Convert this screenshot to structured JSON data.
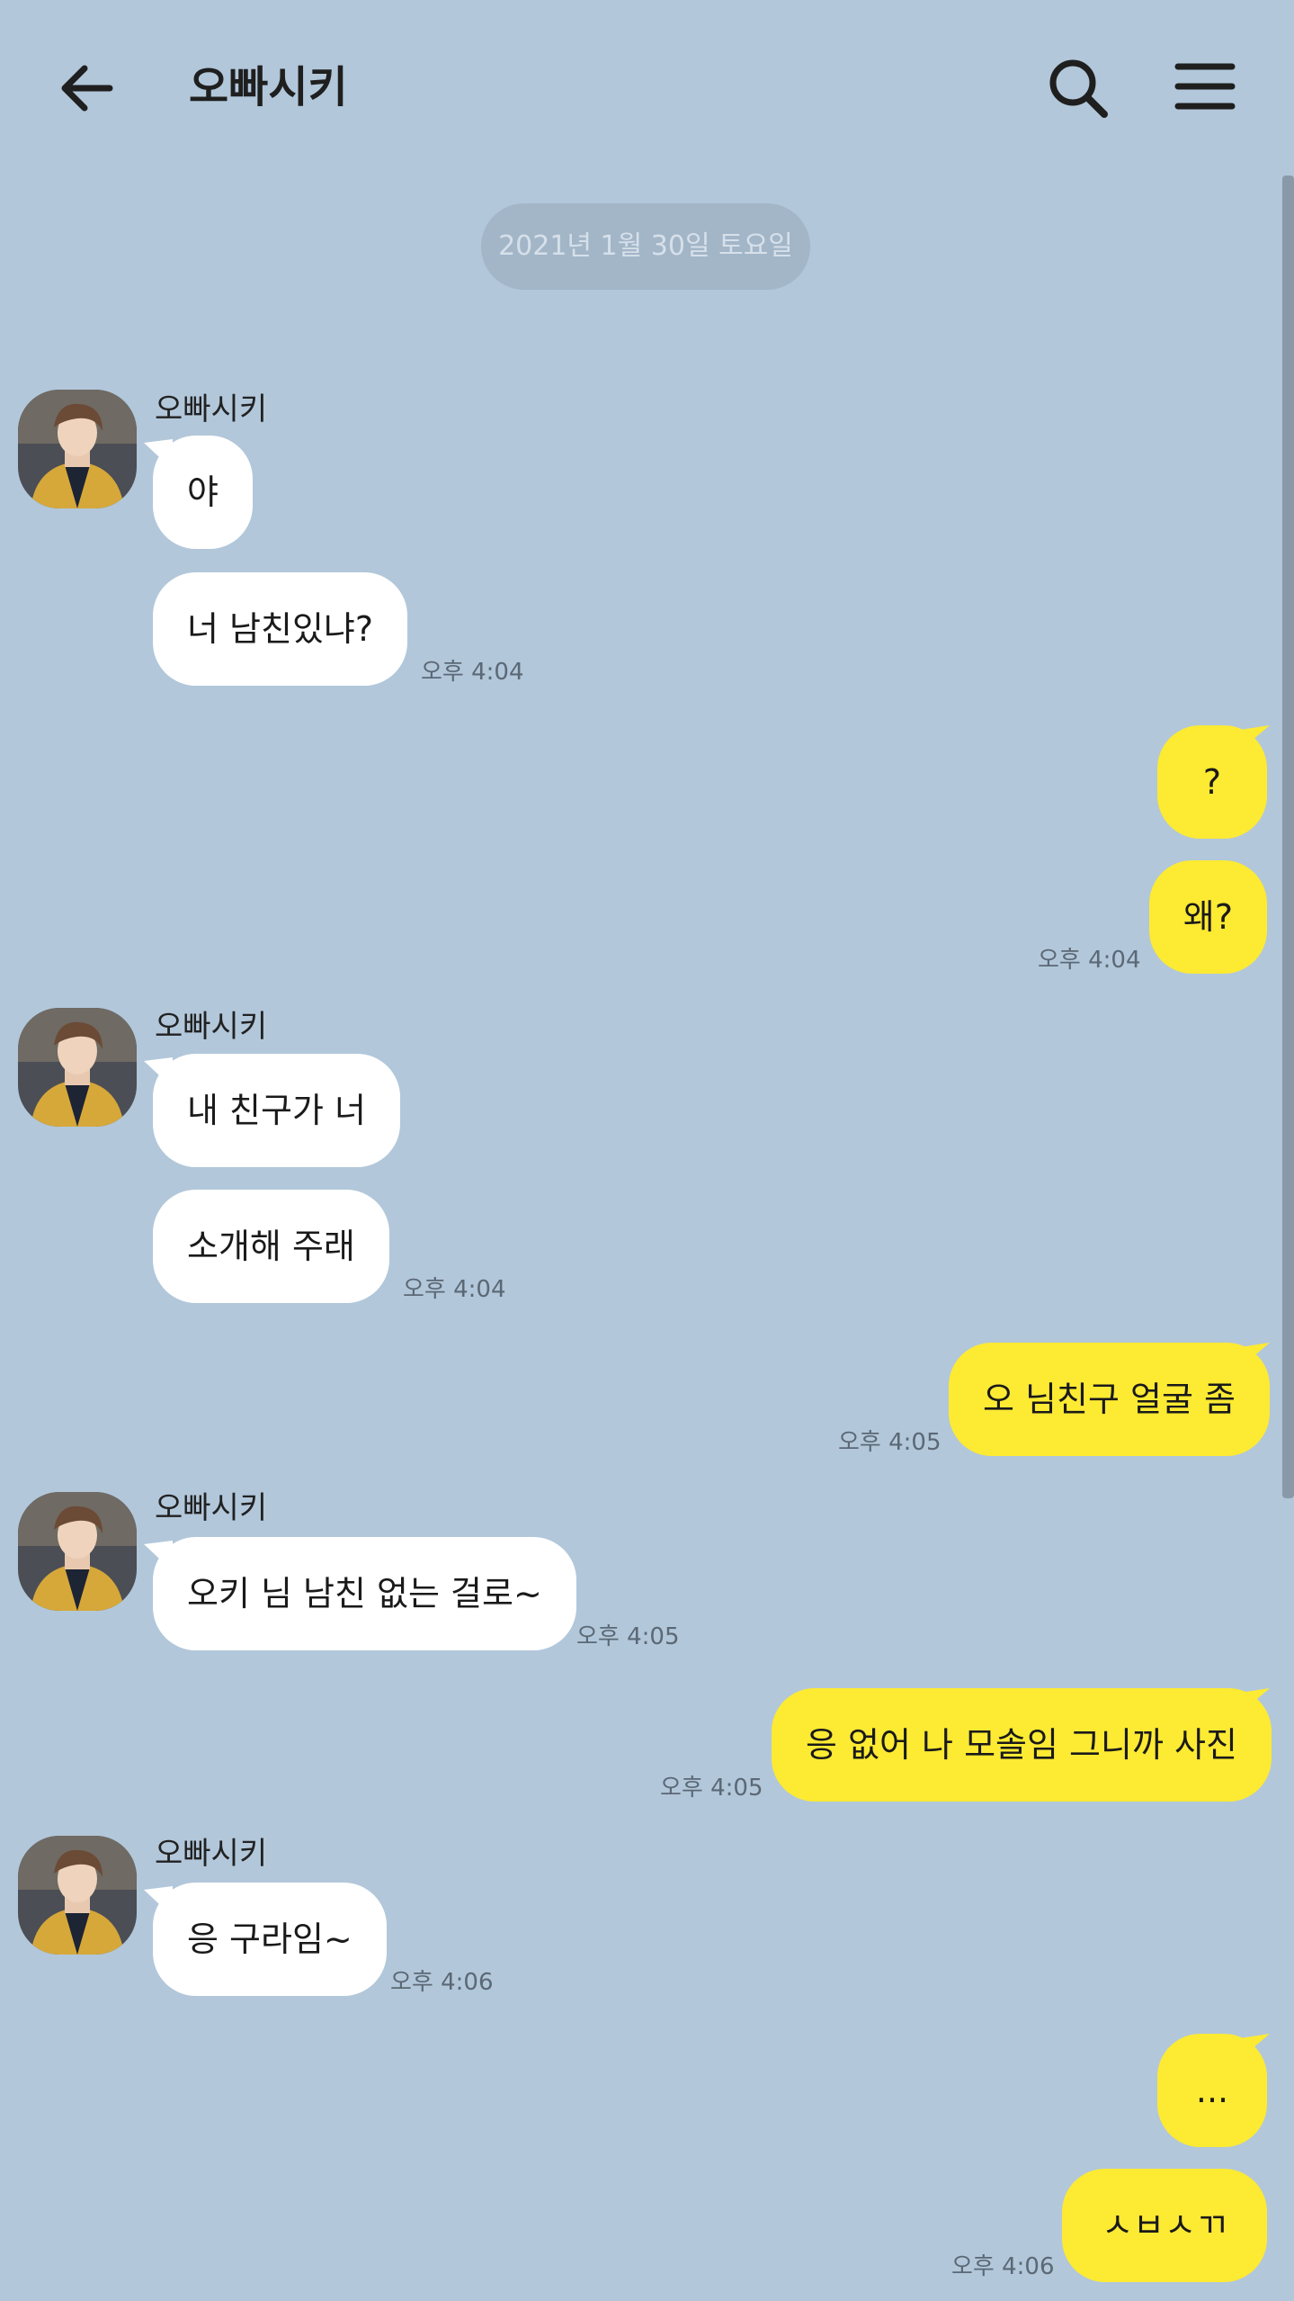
{
  "header": {
    "title": "오빠시키",
    "back_icon": "arrow-left-icon",
    "search_icon": "search-icon",
    "menu_icon": "hamburger-menu-icon"
  },
  "date_divider": "2021년 1월 30일 토요일",
  "colors": {
    "background": "#b2c7da",
    "incoming_bubble": "#ffffff",
    "outgoing_bubble": "#fdea33"
  },
  "messages": [
    {
      "side": "left",
      "sender": "오빠시키",
      "text": "야"
    },
    {
      "side": "left",
      "text": "너 남친있냐?",
      "time": "오후 4:04"
    },
    {
      "side": "right",
      "text": "?"
    },
    {
      "side": "right",
      "text": "왜?",
      "time": "오후 4:04"
    },
    {
      "side": "left",
      "sender": "오빠시키",
      "text": "내 친구가 너"
    },
    {
      "side": "left",
      "text": "소개해 주래",
      "time": "오후 4:04"
    },
    {
      "side": "right",
      "text": "오 님친구 얼굴 좀",
      "time": "오후 4:05"
    },
    {
      "side": "left",
      "sender": "오빠시키",
      "text": "오키 님 남친 없는 걸로~",
      "time": "오후 4:05"
    },
    {
      "side": "right",
      "text": "응 없어 나 모솔임 그니까 사진",
      "time": "오후 4:05"
    },
    {
      "side": "left",
      "sender": "오빠시키",
      "text": "응 구라임~",
      "time": "오후 4:06"
    },
    {
      "side": "right",
      "text": "..."
    },
    {
      "side": "right",
      "text": "ㅅㅂㅅㄲ",
      "time": "오후 4:06"
    }
  ]
}
